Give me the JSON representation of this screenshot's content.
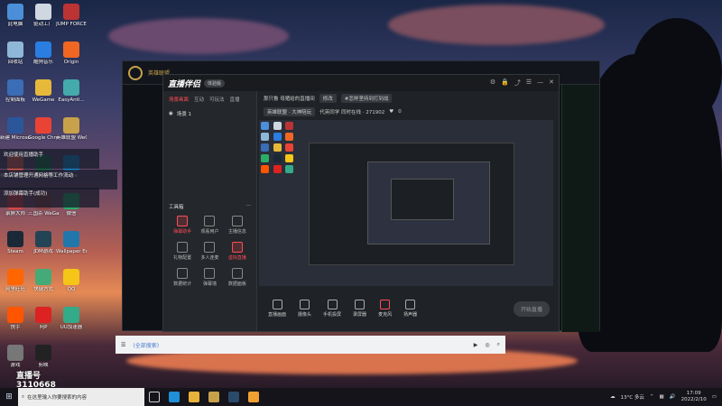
{
  "desktop": {
    "icons": [
      {
        "label": "此电脑",
        "color": "#4a8fd8"
      },
      {
        "label": "驱动工厂",
        "color": "#cfd8e0"
      },
      {
        "label": "JUMP FORCE",
        "color": "#b33"
      },
      {
        "label": "回收站",
        "color": "#8fb8d8"
      },
      {
        "label": "酷狗音乐",
        "color": "#2a7de1"
      },
      {
        "label": "Origin",
        "color": "#f06623"
      },
      {
        "label": "控制面板",
        "color": "#3a6db5"
      },
      {
        "label": "WeGame",
        "color": "#e6b93a"
      },
      {
        "label": "EasyAnti...",
        "color": "#4aa"
      },
      {
        "label": "新建 Microsof...",
        "color": "#2b579a"
      },
      {
        "label": "Google Chrome",
        "color": "#e94335"
      },
      {
        "label": "英雄联盟 WeGame版",
        "color": "#c8a24a"
      },
      {
        "label": "格式工厂 FormatFa...",
        "color": "#e65"
      },
      {
        "label": "7.广州增值税 发票...",
        "color": "#1e7145"
      },
      {
        "label": "Edge",
        "color": "#1f8fd6"
      },
      {
        "label": "录屏大师",
        "color": "#d44"
      },
      {
        "label": "三国杀 WeGame版",
        "color": "#844"
      },
      {
        "label": "微信",
        "color": "#2aae67"
      },
      {
        "label": "Steam",
        "color": "#1b2838"
      },
      {
        "label": "JDM游戏",
        "color": "#245"
      },
      {
        "label": "Wallpaper Engine",
        "color": "#27a"
      },
      {
        "label": "阿里旺旺",
        "color": "#f60"
      },
      {
        "label": "快捷方式",
        "color": "#4a7"
      },
      {
        "label": "QQ",
        "color": "#f5c518"
      },
      {
        "label": "快手",
        "color": "#f50"
      },
      {
        "label": "阿P",
        "color": "#d22"
      },
      {
        "label": "UU加速器",
        "color": "#3a8"
      },
      {
        "label": "游戏",
        "color": "#777"
      },
      {
        "label": "剪映",
        "color": "#222"
      }
    ]
  },
  "notifications": [
    "欢迎使用直播助手",
    "本店铺管理开通网格等工作流动",
    "添加弹幕助手(成功)"
  ],
  "lol": {
    "title": "英雄联盟"
  },
  "live_app": {
    "brand": "直播伴侣",
    "version": "体验版",
    "tabs": [
      "场景画面",
      "互动",
      "可玩法",
      "直播"
    ],
    "scene_label": "场景 1",
    "tools_header": "工具箱",
    "tools": [
      {
        "label": "弹幕助手",
        "red": true
      },
      {
        "label": "观看用户",
        "red": false
      },
      {
        "label": "主播信息",
        "red": false
      },
      {
        "label": "礼物配置",
        "red": false
      },
      {
        "label": "多人连麦",
        "red": false
      },
      {
        "label": "虚拟直播",
        "red": true
      },
      {
        "label": "数据统计",
        "red": false
      },
      {
        "label": "弹幕墙",
        "red": false
      },
      {
        "label": "数据面板",
        "red": false
      }
    ],
    "room_title": "那只鲁 母猪给的直播间",
    "title_edit": "修改",
    "category": "#怎样坚持到打到战",
    "room_tag": "英雄联盟 · 大神陪玩",
    "stats": "代英同学 同时在线 · 271902",
    "likes": "0",
    "bottom_tools": [
      "直播画面",
      "摄像头",
      "手机投屏",
      "录屏器",
      "麦克风",
      "扬声器"
    ],
    "start_button": "开始直播"
  },
  "search_strip": {
    "placeholder": "(全部搜索)"
  },
  "watermark": {
    "line1": "直播号",
    "line2": "3110668"
  },
  "taskbar": {
    "search_placeholder": "在这里输入你要搜索的内容",
    "weather": "13°C 多云",
    "time": "17:09",
    "date": "2022/2/10"
  }
}
